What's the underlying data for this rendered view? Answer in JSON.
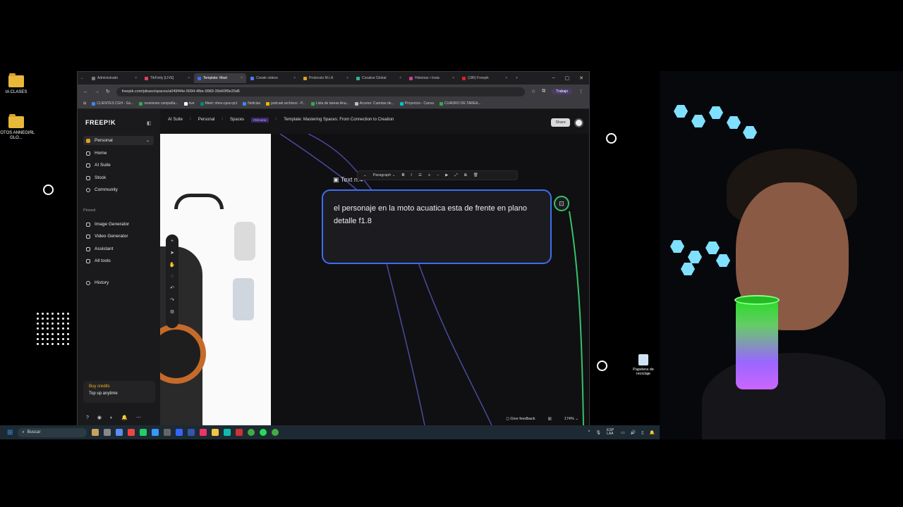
{
  "desktop": {
    "icons": [
      {
        "label": "IA CLASES"
      },
      {
        "label": "FOTOS ANNEGIRL GLO..."
      }
    ],
    "recycle_bin": "Papelera de reciclaje"
  },
  "browser": {
    "tabs": [
      {
        "label": "Administrado",
        "color": "#7a7a7a"
      },
      {
        "label": "TikFinity [LIVE]",
        "color": "#e04060"
      },
      {
        "label": "Template: Mast",
        "color": "#3d6df2",
        "active": true
      },
      {
        "label": "Create videos",
        "color": "#4a7dff"
      },
      {
        "label": "Protocolo M.I.A",
        "color": "#e0a020"
      },
      {
        "label": "Creative Global",
        "color": "#2bb5a0"
      },
      {
        "label": "Historias • Insta",
        "color": "#d04090"
      },
      {
        "label": "(186) Freepik",
        "color": "#e02020"
      }
    ],
    "url": "freepik.com/pikaso/spaces/a049f44e-5094-4fbe-9983-39d43f9e20d6",
    "profile": "Trabajo",
    "bookmarks": [
      {
        "label": "CLIENTES CGH - Go...",
        "color": "#4285f4"
      },
      {
        "label": "reuniones campaña...",
        "color": "#34a853"
      },
      {
        "label": "rive",
        "color": "#ffffff"
      },
      {
        "label": "Meet: nhes-cpuo-pct",
        "color": "#00897b"
      },
      {
        "label": "Noticias",
        "color": "#4285f4"
      },
      {
        "label": "podcast archivos - P...",
        "color": "#f4b400"
      },
      {
        "label": "Lista de tareas Ana...",
        "color": "#34a853"
      },
      {
        "label": "Acceso: Cuentas de...",
        "color": "#bbbbbb"
      },
      {
        "label": "Proyectos - Canva",
        "color": "#00c4cc"
      },
      {
        "label": "CUADRO DE TAREA...",
        "color": "#34a853"
      }
    ]
  },
  "app": {
    "logo": "FREEP!K",
    "workspace": "Personal",
    "nav": [
      "Home",
      "AI Suite",
      "Stock",
      "Community"
    ],
    "pinned_label": "Pinned",
    "pinned": [
      "Image Generator",
      "Video Generator",
      "Assistant",
      "All tools"
    ],
    "history": "History",
    "credits": {
      "title": "Buy credits",
      "subtitle": "Top up anytime"
    },
    "breadcrumb": {
      "ai_suite": "AI Suite",
      "personal": "Personal",
      "spaces": "Spaces",
      "badge": "PREVIEW",
      "title": "Template: Mastering Spaces: From Connection to Creation"
    },
    "share": "Share",
    "node": {
      "label": "Text n.4",
      "text": "el personaje en la moto acuatica esta de frente en plano detalle f1.8",
      "format": "Paragraph"
    },
    "feedback": "Give feedback",
    "zoom": "174%"
  },
  "taskbar": {
    "search": "Buscar",
    "lang": "ESP LAA"
  }
}
